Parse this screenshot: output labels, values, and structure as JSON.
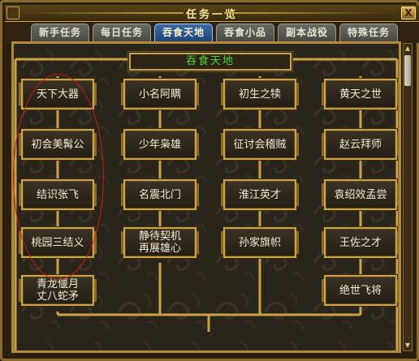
{
  "window": {
    "title": "任务一览",
    "close_label": "X"
  },
  "tabs": [
    {
      "label": "新手任务",
      "active": false
    },
    {
      "label": "每日任务",
      "active": false
    },
    {
      "label": "吞食天地",
      "active": true
    },
    {
      "label": "吞食小品",
      "active": false
    },
    {
      "label": "副本战役",
      "active": false
    },
    {
      "label": "特殊任务",
      "active": false
    }
  ],
  "panel": {
    "header": "吞食天地"
  },
  "quests": {
    "col1": [
      "天下大器",
      "初会美髯公",
      "结识张飞",
      "桃园三结义",
      "青龙偃月\n丈八蛇矛"
    ],
    "col2": [
      "小名阿瞒",
      "少年枭雄",
      "名震北门",
      "静待契机\n再展雄心"
    ],
    "col3": [
      "初生之犊",
      "征讨会稽贼",
      "淮江英才",
      "孙家旗帜"
    ],
    "col4": [
      "黄天之世",
      "赵云拜师",
      "袁绍效孟尝",
      "王佐之才",
      "绝世飞将"
    ]
  },
  "colors": {
    "accent_gold": "#c9a24a",
    "header_text": "#4cd33c",
    "highlight_red": "#d01818",
    "active_tab": "#2a5290"
  }
}
